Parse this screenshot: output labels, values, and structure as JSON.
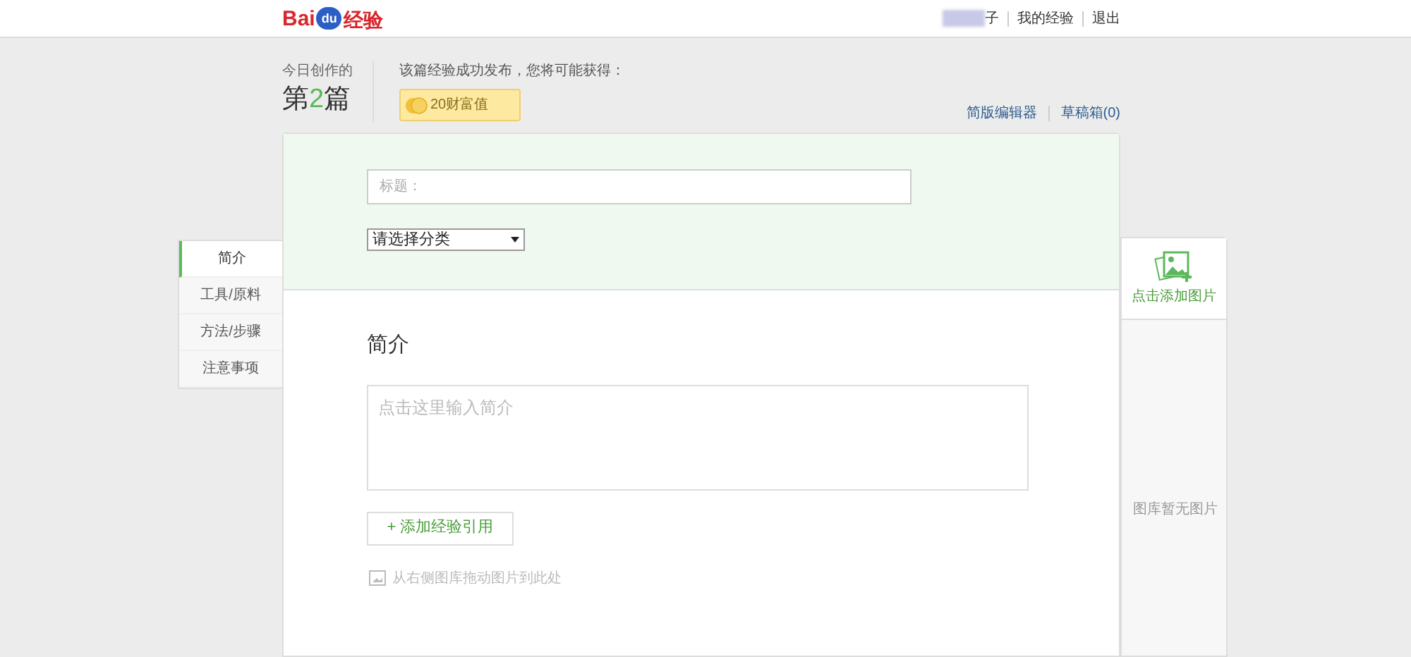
{
  "header": {
    "logo": {
      "text_before": "Bai",
      "paw_text": "du",
      "text_after": "经验"
    },
    "user_name": "子",
    "links": [
      {
        "label": "我的经验"
      },
      {
        "label": "退出"
      }
    ]
  },
  "today": {
    "label": "今日创作的",
    "count_prefix": "第",
    "count": "2",
    "count_suffix": "篇"
  },
  "reward": {
    "text": "该篇经验成功发布，您将可能获得：",
    "badge": "20财富值"
  },
  "top_links": [
    {
      "label": "简版编辑器"
    },
    {
      "label": "草稿箱(0)"
    }
  ],
  "nav": [
    {
      "label": "简介",
      "selected": true
    },
    {
      "label": "工具/原料",
      "selected": false
    },
    {
      "label": "方法/步骤",
      "selected": false
    },
    {
      "label": "注意事项",
      "selected": false
    }
  ],
  "form": {
    "title_placeholder": "标题：",
    "category": "请选择分类",
    "section_heading": "简介",
    "intro_placeholder": "点击这里输入简介",
    "add_reference": "+ 添加经验引用",
    "drag_hint": "从右侧图库拖动图片到此处"
  },
  "gallery": {
    "add_label": "点击添加图片",
    "empty_text": "图库暂无图片"
  }
}
